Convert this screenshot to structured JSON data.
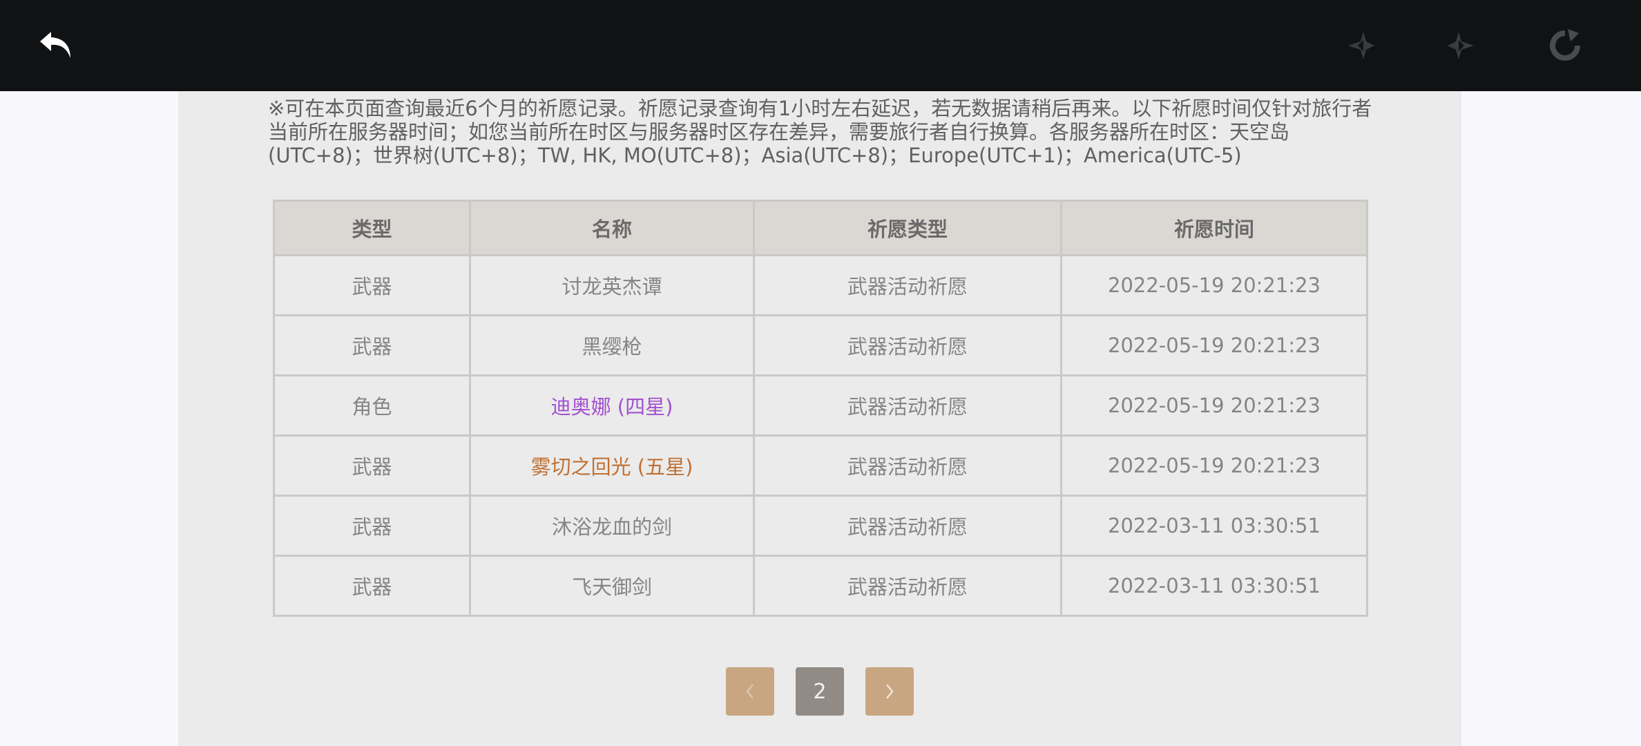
{
  "toolbar": {
    "back_icon": "undo-arrow-icon",
    "prev_icon": "star-back-icon",
    "next_icon": "star-forward-icon",
    "reload_icon": "reload-icon"
  },
  "notice": "※可在本页面查询最近6个月的祈愿记录。祈愿记录查询有1小时左右延迟，若无数据请稍后再来。以下祈愿时间仅针对旅行者当前所在服务器时间；如您当前所在时区与服务器时区存在差异，需要旅行者自行换算。各服务器所在时区：天空岛(UTC+8)；世界树(UTC+8)；TW, HK, MO(UTC+8)；Asia(UTC+8)；Europe(UTC+1)；America(UTC-5)",
  "table": {
    "headers": [
      "类型",
      "名称",
      "祈愿类型",
      "祈愿时间"
    ],
    "rows": [
      {
        "type": "武器",
        "name": "讨龙英杰谭",
        "wish_type": "武器活动祈愿",
        "time": "2022-05-19 20:21:23",
        "rarity": "normal"
      },
      {
        "type": "武器",
        "name": "黑缨枪",
        "wish_type": "武器活动祈愿",
        "time": "2022-05-19 20:21:23",
        "rarity": "normal"
      },
      {
        "type": "角色",
        "name": "迪奥娜 (四星)",
        "wish_type": "武器活动祈愿",
        "time": "2022-05-19 20:21:23",
        "rarity": "four"
      },
      {
        "type": "武器",
        "name": "雾切之回光 (五星)",
        "wish_type": "武器活动祈愿",
        "time": "2022-05-19 20:21:23",
        "rarity": "five"
      },
      {
        "type": "武器",
        "name": "沐浴龙血的剑",
        "wish_type": "武器活动祈愿",
        "time": "2022-03-11 03:30:51",
        "rarity": "normal"
      },
      {
        "type": "武器",
        "name": "飞天御剑",
        "wish_type": "武器活动祈愿",
        "time": "2022-03-11 03:30:51",
        "rarity": "normal"
      }
    ]
  },
  "pagination": {
    "current_page": "2",
    "prev_icon": "chevron-left-icon",
    "next_icon": "chevron-right-icon"
  },
  "colors": {
    "four_star": "#a24fd0",
    "five_star": "#c07034",
    "pager_button": "#c8a682",
    "pager_current": "#928b85"
  }
}
